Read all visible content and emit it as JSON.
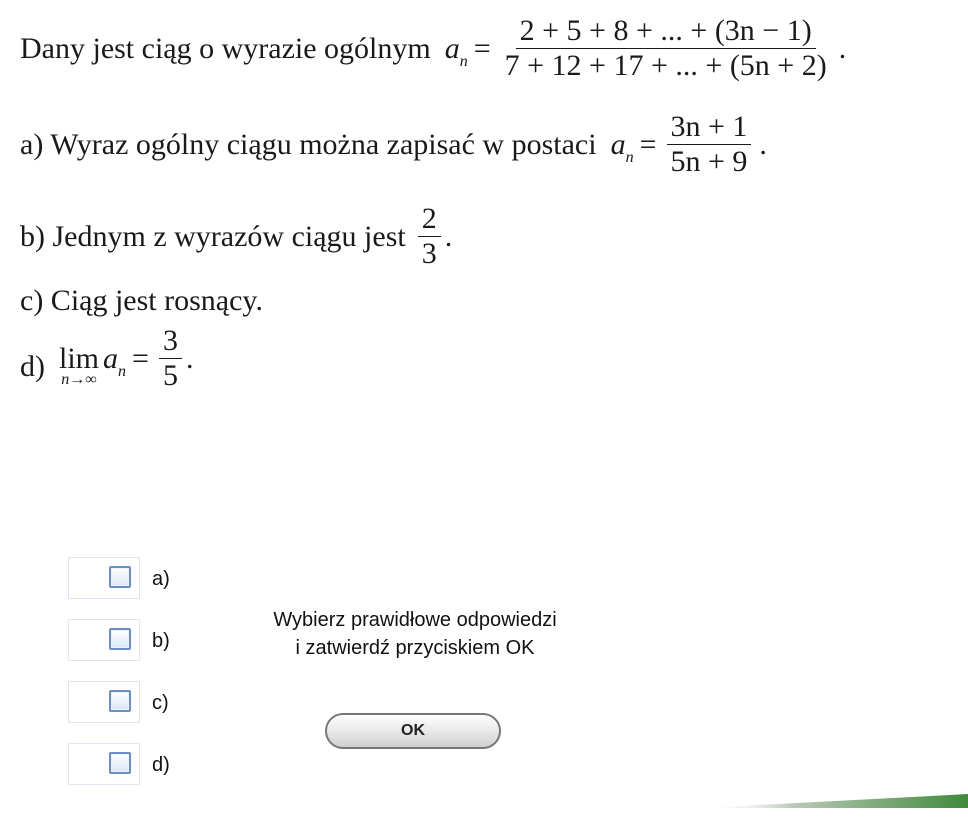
{
  "question": {
    "intro_text": "Dany jest ciąg o wyrazie ogólnym",
    "a_var": "a",
    "n_sub": "n",
    "eq": "=",
    "intro_numerator": "2 + 5 + 8 + ... + (3n − 1)",
    "intro_denominator": "7 + 12 + 17 + ... + (5n + 2)",
    "period": "."
  },
  "option_a": {
    "text": "a) Wyraz ogólny ciągu można zapisać w postaci",
    "numerator": "3n + 1",
    "denominator": "5n + 9"
  },
  "option_b": {
    "text": "b) Jednym z wyrazów ciągu jest",
    "numerator": "2",
    "denominator": "3"
  },
  "option_c": {
    "text": "c) Ciąg jest rosnący."
  },
  "option_d": {
    "prefix": "d)",
    "lim": "lim",
    "lim_sub": "n→∞",
    "numerator": "3",
    "denominator": "5"
  },
  "checkboxes": [
    {
      "label": "a)",
      "checked": false
    },
    {
      "label": "b)",
      "checked": false
    },
    {
      "label": "c)",
      "checked": false
    },
    {
      "label": "d)",
      "checked": false
    }
  ],
  "instruction": {
    "line1": "Wybierz prawidłowe odpowiedzi",
    "line2": "i zatwierdź przyciskiem OK"
  },
  "ok_button": "OK",
  "colors": {
    "checkbox_border": "#6a8fc4",
    "accent_bar": "#3f8a3a"
  }
}
